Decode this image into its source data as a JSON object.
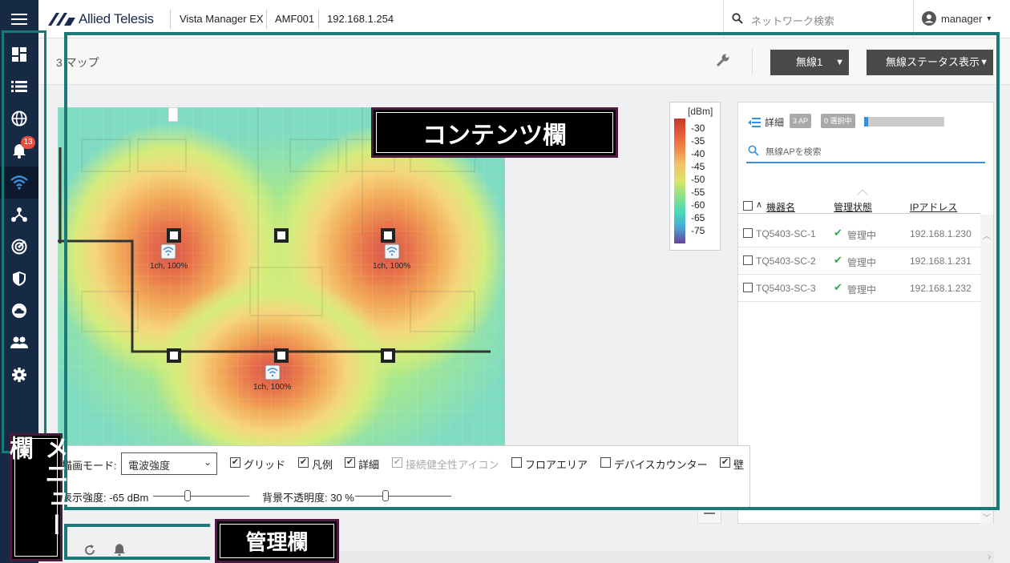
{
  "topbar": {
    "logo": "Allied Telesis",
    "product": "Vista Manager EX",
    "device": "AMF001",
    "ip": "192.168.1.254",
    "search_placeholder": "ネットワーク検索",
    "user": "manager"
  },
  "sidebar": {
    "items": [
      {
        "icon": "dashboard-icon"
      },
      {
        "icon": "list-icon"
      },
      {
        "icon": "globe-icon"
      },
      {
        "icon": "bell-icon",
        "badge": "13"
      },
      {
        "icon": "wifi-icon",
        "active": true
      },
      {
        "icon": "topology-icon"
      },
      {
        "icon": "radar-icon"
      },
      {
        "icon": "shield-icon"
      },
      {
        "icon": "cloud-icon"
      },
      {
        "icon": "users-icon"
      },
      {
        "icon": "gear-icon"
      }
    ]
  },
  "header": {
    "title": "3 マップ",
    "dropdown1": "無線1",
    "dropdown2": "無線ステータス表示"
  },
  "map": {
    "ap_labels": [
      "1ch, 100%",
      "1ch, 100%",
      "1ch, 100%"
    ]
  },
  "legend": {
    "unit": "[dBm]",
    "ticks": [
      "-30",
      "-35",
      "-40",
      "-45",
      "-50",
      "-55",
      "-60",
      "-65",
      "-75"
    ]
  },
  "panel": {
    "detail_label": "詳細",
    "ap_count": "3 AP",
    "selected": "0 選択中",
    "selected_fraction": 0.05,
    "search_placeholder": "無線APを検索",
    "col_name": "機器名",
    "col_state": "管理状態",
    "col_ip": "IPアドレス",
    "rows": [
      {
        "name": "TQ5403-SC-1",
        "state": "管理中",
        "ip": "192.168.1.230"
      },
      {
        "name": "TQ5403-SC-2",
        "state": "管理中",
        "ip": "192.168.1.231"
      },
      {
        "name": "TQ5403-SC-3",
        "state": "管理中",
        "ip": "192.168.1.232"
      }
    ]
  },
  "settings": {
    "mode_label": "描画モード:",
    "mode_value": "電波強度",
    "checks": [
      {
        "label": "グリッド",
        "checked": true
      },
      {
        "label": "凡例",
        "checked": true
      },
      {
        "label": "詳細",
        "checked": true
      },
      {
        "label": "接続健全性アイコン",
        "checked": true,
        "disabled": true
      },
      {
        "label": "フロアエリア",
        "checked": false
      },
      {
        "label": "デバイスカウンター",
        "checked": false
      },
      {
        "label": "壁",
        "checked": true
      }
    ],
    "strength_label": "表示強度: -65 dBm",
    "opacity_label": "背景不透明度: 30 %"
  },
  "annotations": {
    "content": "コンテンツ欄",
    "menu": "メニュー欄",
    "admin": "管理欄"
  },
  "colors": {
    "sidebar": "#172a45",
    "annotation_frame": "#1a7a76",
    "accent": "#3a8fd6"
  }
}
